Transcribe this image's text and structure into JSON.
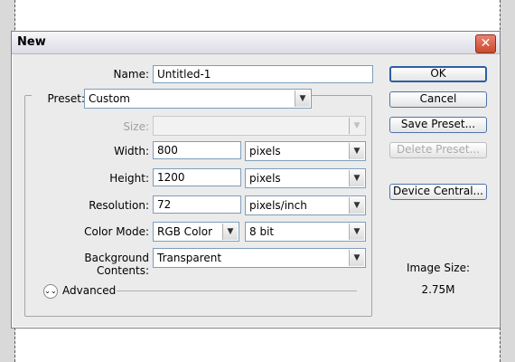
{
  "dialog": {
    "title": "New",
    "close_glyph": "✕"
  },
  "form": {
    "name_label": "Name:",
    "name_value": "Untitled-1",
    "preset_label": "Preset:",
    "preset_value": "Custom",
    "size_label": "Size:",
    "size_value": "",
    "width_label": "Width:",
    "width_value": "800",
    "width_unit": "pixels",
    "height_label": "Height:",
    "height_value": "1200",
    "height_unit": "pixels",
    "resolution_label": "Resolution:",
    "resolution_value": "72",
    "resolution_unit": "pixels/inch",
    "color_mode_label": "Color Mode:",
    "color_mode_value": "RGB Color",
    "bit_depth_value": "8 bit",
    "background_label": "Background Contents:",
    "background_value": "Transparent",
    "advanced_label": "Advanced"
  },
  "buttons": {
    "ok": "OK",
    "cancel": "Cancel",
    "save_preset": "Save Preset...",
    "delete_preset": "Delete Preset...",
    "device_central": "Device Central..."
  },
  "info": {
    "image_size_label": "Image Size:",
    "image_size_value": "2.75M"
  },
  "icons": {
    "dropdown": "chevron-down-icon",
    "close": "close-icon",
    "advanced": "expand-icon"
  },
  "colors": {
    "close_button": "#c84a2f",
    "button_border": "#4f74a8"
  }
}
